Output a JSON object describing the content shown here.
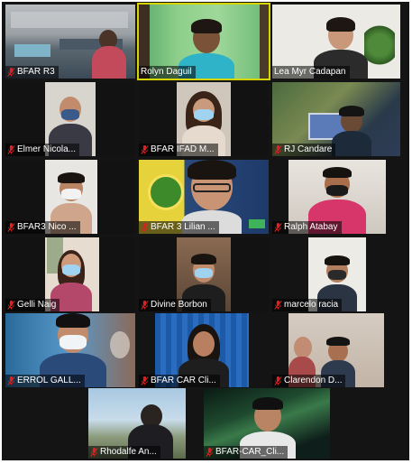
{
  "meeting": {
    "participants": [
      {
        "name": "BFAR R3",
        "muted": true
      },
      {
        "name": "Rolyn Daguil",
        "muted": false,
        "active_speaker": true
      },
      {
        "name": "Lea Myr Cadapan",
        "muted": false
      },
      {
        "name": "Elmer Nicola...",
        "muted": true
      },
      {
        "name": "BFAR IFAD M...",
        "muted": true
      },
      {
        "name": "RJ Candare",
        "muted": true
      },
      {
        "name": "BFAR3 Nico ...",
        "muted": true
      },
      {
        "name": "BFAR 3 Lilian ...",
        "muted": true
      },
      {
        "name": "Ralph Atabay",
        "muted": true
      },
      {
        "name": "Gelli Naig",
        "muted": true
      },
      {
        "name": "Divine Borbon",
        "muted": true
      },
      {
        "name": "marcelo racia",
        "muted": true
      },
      {
        "name": "ERROL GALL...",
        "muted": true
      },
      {
        "name": "BFAR CAR Cli...",
        "muted": true
      },
      {
        "name": "Clarendon D...",
        "muted": true
      },
      {
        "name": "Rhodalfe An...",
        "muted": true
      },
      {
        "name": "BFAR-CAR_Cli...",
        "muted": true
      }
    ]
  },
  "colors": {
    "active_speaker_border": "#d7d400",
    "muted_icon": "#e02020",
    "gallery_background": "#141414"
  },
  "icons": {
    "muted": "microphone-muted-icon"
  }
}
